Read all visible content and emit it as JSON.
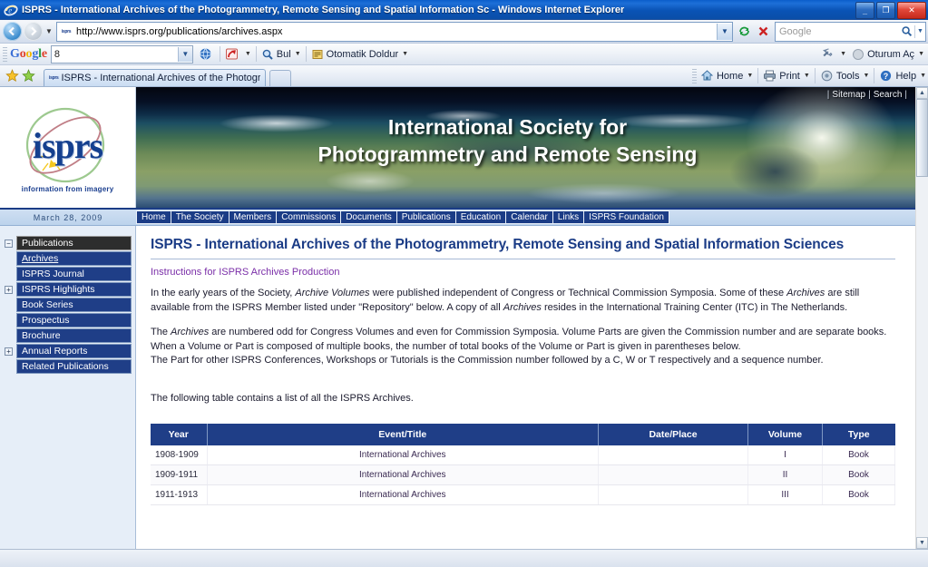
{
  "window": {
    "title": "ISPRS - International Archives of the Photogrammetry, Remote Sensing and Spatial Information Sc - Windows Internet Explorer",
    "app_icon": "internet-explorer-icon",
    "minimize_label": "_",
    "restore_label": "❐",
    "close_label": "✕"
  },
  "address_bar": {
    "back_icon": "back-arrow-icon",
    "forward_icon": "forward-arrow-icon",
    "history_caret": "▼",
    "favicon_text": "isprs",
    "url": "http://www.isprs.org/publications/archives.aspx",
    "url_dropdown": "▼",
    "refresh_icon": "refresh-icon",
    "stop_icon": "stop-icon",
    "search_placeholder": "Google",
    "search_icon": "magnifier-icon",
    "search_dropdown": "▼"
  },
  "google_toolbar": {
    "brand_letters": [
      "G",
      "o",
      "o",
      "g",
      "l",
      "e"
    ],
    "query": "8",
    "query_dropdown": "▼",
    "items": [
      {
        "label": "",
        "icon": "globe-icon",
        "caret": ""
      },
      {
        "label": "",
        "icon": "pagerank-icon",
        "caret": "▼"
      },
      {
        "label": "Bul",
        "icon": "find-magnifier-icon",
        "caret": "▼"
      },
      {
        "label": "Otomatik Doldur",
        "icon": "autofill-icon",
        "caret": "▼"
      }
    ],
    "right_items": [
      {
        "label": "",
        "icon": "wrench-icon",
        "caret": "▼"
      },
      {
        "label": "Oturum Aç",
        "icon": "signin-icon",
        "caret": "▼"
      }
    ]
  },
  "tab_bar": {
    "favorites_star_icon": "favorites-star-icon",
    "add_favorite_icon": "add-favorite-icon",
    "tab": {
      "favicon_text": "isprs",
      "label": "ISPRS - International Archives of the Photogrammetr…"
    },
    "new_tab_label": "",
    "command_items": [
      {
        "label": "Home",
        "icon": "home-icon",
        "caret": "▼"
      },
      {
        "label": "Print",
        "icon": "printer-icon",
        "caret": "▼"
      },
      {
        "label": "Tools",
        "icon": "gear-icon",
        "caret": "▼"
      },
      {
        "label": "Help",
        "icon": "help-icon",
        "caret": "▼"
      }
    ]
  },
  "site": {
    "logo_word": "isprs",
    "logo_tagline": "information from imagery",
    "banner_line1": "International Society for",
    "banner_line2": "Photogrammetry and Remote Sensing",
    "top_links": [
      "Sitemap",
      "Search"
    ],
    "date": "March 28, 2009",
    "nav_items": [
      "Home",
      "The Society",
      "Members",
      "Commissions",
      "Documents",
      "Publications",
      "Education",
      "Calendar",
      "Links",
      "ISPRS Foundation"
    ]
  },
  "sidebar": {
    "items": [
      {
        "label": "Publications",
        "expander": "−",
        "current": true
      },
      {
        "label": "Archives",
        "expander": "",
        "underline": true
      },
      {
        "label": "ISPRS Journal",
        "expander": ""
      },
      {
        "label": "ISPRS Highlights",
        "expander": "+"
      },
      {
        "label": "Book Series",
        "expander": ""
      },
      {
        "label": "Prospectus",
        "expander": ""
      },
      {
        "label": "Brochure",
        "expander": ""
      },
      {
        "label": "Annual Reports",
        "expander": "+"
      },
      {
        "label": "Related Publications",
        "expander": ""
      }
    ]
  },
  "main": {
    "heading": "ISPRS - International Archives of the Photogrammetry, Remote Sensing and Spatial Information Sciences",
    "instructions_link": "Instructions for ISPRS Archives Production",
    "paragraph1_a": "In the early years of the Society, ",
    "paragraph1_i1": "Archive Volumes",
    "paragraph1_b": " were published independent of Congress or Technical Commission Symposia. Some of these ",
    "paragraph1_i2": "Archives",
    "paragraph1_c": " are still available from the ISPRS Member listed under \"Repository\" below. A copy of all ",
    "paragraph1_i3": "Archives",
    "paragraph1_d": " resides in the International Training Center (ITC) in The Netherlands.",
    "paragraph2_a": "The ",
    "paragraph2_i1": "Archives",
    "paragraph2_b": " are numbered odd for Congress Volumes and even for Commission Symposia. Volume Parts are given the Commission number and are separate books. When a Volume or Part is composed of multiple books, the number of total books of the Volume or Part is given in parentheses below.",
    "paragraph3": "The Part for other ISPRS Conferences, Workshops or Tutorials is the Commission number followed by a C, W or T respectively and a sequence number.",
    "paragraph4": "The following table contains a list of all the ISPRS Archives."
  },
  "table": {
    "columns": [
      "Year",
      "Event/Title",
      "Date/Place",
      "Volume",
      "Type"
    ],
    "rows": [
      {
        "year": "1908-1909",
        "event": "International Archives",
        "date_place": "",
        "volume": "I",
        "type": "Book"
      },
      {
        "year": "1909-1911",
        "event": "International Archives",
        "date_place": "",
        "volume": "II",
        "type": "Book"
      },
      {
        "year": "1911-1913",
        "event": "International Archives",
        "date_place": "",
        "volume": "III",
        "type": "Book"
      }
    ]
  },
  "scrollbar": {
    "up_arrow": "▲",
    "down_arrow": "▼"
  },
  "colors": {
    "brand_blue": "#1f3e87",
    "titlebar_blue": "#0a53b5",
    "sidebar_bg": "#e6eef8",
    "link_purple": "#7a2ea8"
  }
}
